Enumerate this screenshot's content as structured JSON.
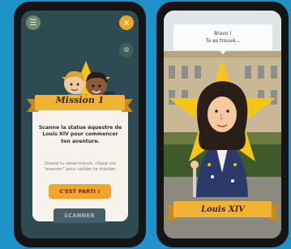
{
  "left_screen": {
    "icons": {
      "menu": "hamburger-menu-icon",
      "close": "close-icon",
      "target": "crosshair-icon"
    },
    "close_glyph": "✕",
    "menu_glyph": "☰",
    "target_glyph": "⊕",
    "mission_title": "Mission 1",
    "mission_text": "Scanne la statue équestre de Louis XIV pour commencer ton aventure.",
    "hint_text": "Quand tu seras trouvé, clique sur \"scanner\" pour valider ta mission.",
    "start_button_label": "C'EST PARTI !",
    "scan_button_label": "SCANNER"
  },
  "right_screen": {
    "bubble_line1": "Bravo !",
    "bubble_line2": "Tu es trouvé...",
    "character_name": "Louis XIV"
  },
  "colors": {
    "background": "#1f93c9",
    "ribbon": "#f2b233",
    "button_orange": "#f2a52a",
    "star": "#f5c518"
  }
}
